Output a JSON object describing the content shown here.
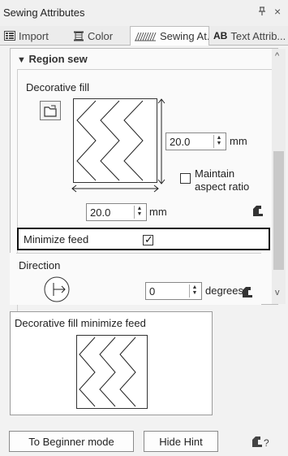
{
  "window": {
    "title": "Sewing Attributes",
    "pin_icon": "pin-icon",
    "close_glyph": "×"
  },
  "tabs": [
    {
      "label": "Import",
      "icon": "import-icon",
      "active": false
    },
    {
      "label": "Color",
      "icon": "color-icon",
      "active": false
    },
    {
      "label": "Sewing At...",
      "icon": "sewing-pattern-icon",
      "active": true
    },
    {
      "label": "Text Attrib...",
      "prefix": "AB",
      "icon": "text-ab-icon",
      "active": false
    }
  ],
  "section": {
    "title": "Region sew",
    "fill_label": "Decorative fill",
    "height_value": "20.0",
    "height_unit": "mm",
    "width_value": "20.0",
    "width_unit": "mm",
    "maintain_aspect_label_1": "Maintain",
    "maintain_aspect_label_2": "aspect ratio",
    "maintain_aspect_checked": false,
    "minimize_feed_label": "Minimize feed",
    "minimize_feed_checked": true,
    "direction_label": "Direction",
    "direction_value": "0",
    "direction_unit": "degrees"
  },
  "hint": {
    "title": "Decorative fill minimize feed"
  },
  "buttons": {
    "beginner": "To Beginner mode",
    "hide_hint": "Hide Hint"
  },
  "colors": {
    "panel_bg": "#fafafa",
    "window_bg": "#f2f2f2",
    "border": "#bcbcbc"
  }
}
